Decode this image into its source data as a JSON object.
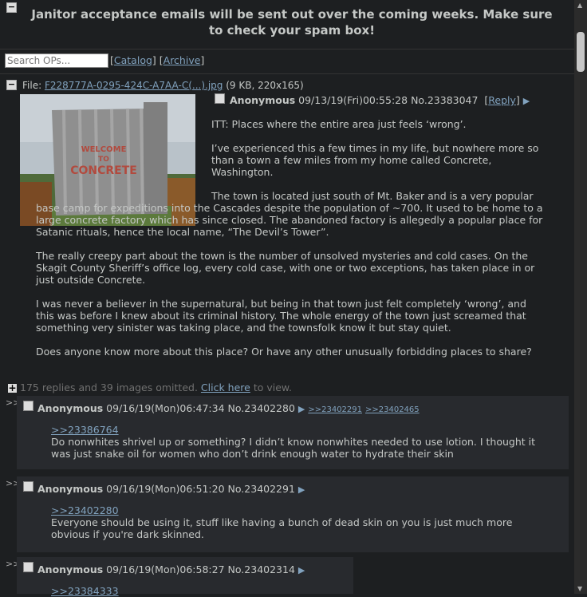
{
  "banner": "Janitor acceptance emails will be sent out over the coming weeks. Make sure to check your spam box!",
  "search": {
    "placeholder": "Search OPs..."
  },
  "nav": {
    "catalog": "Catalog",
    "archive": "Archive"
  },
  "op": {
    "file_label": "File:",
    "file_name": "F228777A-0295-424C-A7AA-C(...).jpg",
    "file_meta": "(9 KB, 220x165)",
    "name": "Anonymous",
    "datetime": "09/13/19(Fri)00:55:28",
    "number": "No.23383047",
    "reply": "Reply",
    "image_text": "WELCOME TO CONCRETE",
    "paragraphs": [
      "ITT: Places where the entire area just feels ‘wrong’.",
      "I’ve experienced this a few times in my life, but nowhere more so than a town a few miles from my home called Concrete, Washington.",
      "The town is located just south of Mt. Baker and is a very popular base camp for expeditions into the Cascades despite the population of ~700. It used to be home to a large concrete factory which has since closed. The abandoned factory is allegedly a popular place for Satanic rituals, hence the local name, “The Devil’s Tower”.",
      "The really creepy part about the town is the number of unsolved mysteries and cold cases. On the Skagit County Sheriff’s office log, every cold case, with one or two exceptions, has taken place in or just outside Concrete.",
      "I was never a believer in the supernatural, but being in that town just felt completely ‘wrong’, and this was before I knew about its criminal history. The whole energy of the town just screamed that something very sinister was taking place, and the townsfolk know it but stay quiet.",
      "Does anyone know more about this place? Or have any other unusually forbidding places to share?"
    ]
  },
  "omitted": {
    "text": "175 replies and 39 images omitted.",
    "link": "Click here",
    "suffix": "to view."
  },
  "replies": [
    {
      "name": "Anonymous",
      "datetime": "09/16/19(Mon)06:47:34",
      "number": "No.23402280",
      "backlinks": [
        ">>23402291",
        ">>23402465"
      ],
      "quote": ">>23386764",
      "text": "Do nonwhites shrivel up or something? I didn’t know nonwhites needed to use lotion. I thought it was just snake oil for women who don’t drink enough water to hydrate their skin"
    },
    {
      "name": "Anonymous",
      "datetime": "09/16/19(Mon)06:51:20",
      "number": "No.23402291",
      "backlinks": [],
      "quote": ">>23402280",
      "text": "Everyone should be using it, stuff like having a bunch of dead skin on you is just much more obvious if you're dark skinned."
    },
    {
      "name": "Anonymous",
      "datetime": "09/16/19(Mon)06:58:27",
      "number": "No.23402314",
      "backlinks": [],
      "quote": ">>23384333",
      "text": ""
    }
  ]
}
